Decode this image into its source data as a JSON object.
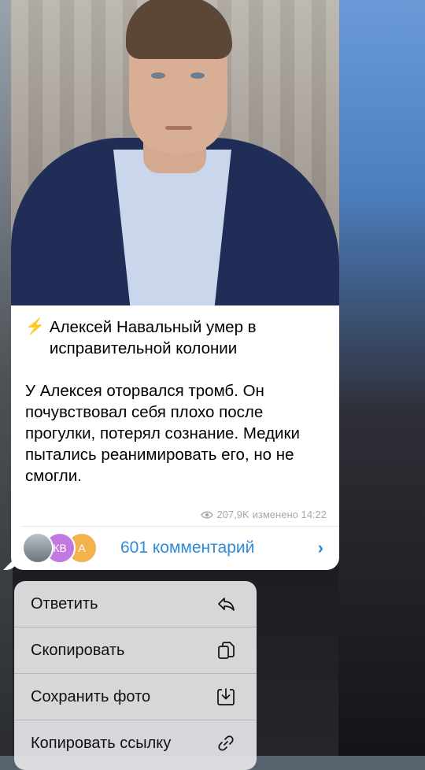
{
  "post": {
    "headline": "Алексей Навальный умер в исправительной колонии",
    "body": "У Алексея оторвался тромб. Он почувствовал себя плохо после прогулки, потерял сознание. Медики пытались реанимировать его, но не смогли.",
    "views": "207,9K",
    "edited": "изменено 14:22"
  },
  "comments": {
    "label": "601 комментарий",
    "avatars": [
      "",
      "КВ",
      "А"
    ]
  },
  "menu": {
    "items": [
      {
        "label": "Ответить",
        "icon": "reply-icon"
      },
      {
        "label": "Скопировать",
        "icon": "copy-icon"
      },
      {
        "label": "Сохранить фото",
        "icon": "save-photo-icon"
      },
      {
        "label": "Копировать ссылку",
        "icon": "link-icon"
      }
    ]
  }
}
